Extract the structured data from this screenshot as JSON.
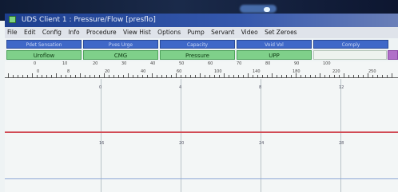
{
  "window": {
    "title": "UDS Client 1 : Pressure/Flow [presflo]"
  },
  "menu": [
    "File",
    "Edit",
    "Config",
    "Info",
    "Procedure",
    "View Hist",
    "Options",
    "Pump",
    "Servant",
    "Video",
    "Set Zeroes"
  ],
  "channel_header": {
    "top_labels": [
      "Pdet Sensation",
      "Pves Urge",
      "Capacity",
      "Void Vol",
      "Comply"
    ],
    "buttons": [
      "Uroflow",
      "CMG",
      "Pressure",
      "UPP",
      "",
      ""
    ]
  },
  "scale": {
    "row1": [
      "0",
      "10",
      "20",
      "30",
      "40",
      "50",
      "60",
      "70",
      "80",
      "90",
      "100"
    ],
    "row2": [
      "0",
      "8",
      "20",
      "40",
      "60",
      "100",
      "140",
      "180",
      "220",
      "250"
    ],
    "grid_labels": [
      "0",
      "4",
      "8",
      "12",
      "16",
      "20",
      "24",
      "28"
    ]
  },
  "colors": {
    "title_bar": "#1d3f8f",
    "header_blue": "#3f68c8",
    "header_green": "#7fd08a",
    "trace_red": "#d14b55",
    "accent_purple": "#b070c8"
  }
}
